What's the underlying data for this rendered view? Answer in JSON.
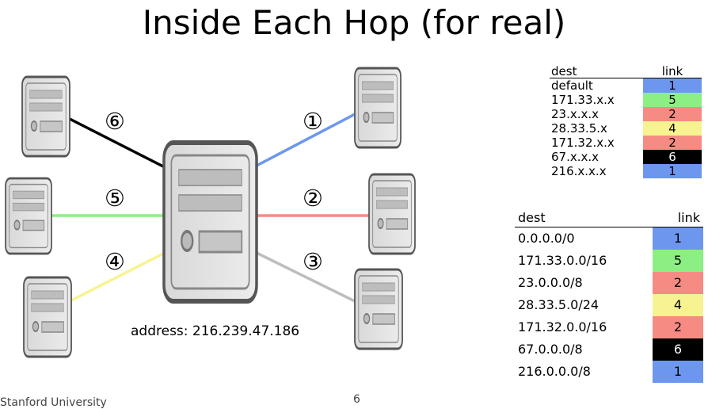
{
  "title": "Inside Each Hop (for real)",
  "address_label": "address: 216.239.47.186",
  "footer": "Stanford University",
  "page_number": "6",
  "link_labels": [
    "①",
    "②",
    "③",
    "④",
    "⑤",
    "⑥"
  ],
  "link_colors": {
    "1": "#6d97ee",
    "2": "#f58b82",
    "3": "#bdbdbd",
    "4": "#f7f390",
    "5": "#8cef83",
    "6": "#000000"
  },
  "table_small": {
    "headers": [
      "dest",
      "link"
    ],
    "rows": [
      {
        "dest": "default",
        "link": "1"
      },
      {
        "dest": "171.33.x.x",
        "link": "5"
      },
      {
        "dest": "23.x.x.x",
        "link": "2"
      },
      {
        "dest": "28.33.5.x",
        "link": "4"
      },
      {
        "dest": "171.32.x.x",
        "link": "2"
      },
      {
        "dest": "67.x.x.x",
        "link": "6"
      },
      {
        "dest": "216.x.x.x",
        "link": "1"
      }
    ]
  },
  "table_big": {
    "headers": [
      "dest",
      "link"
    ],
    "rows": [
      {
        "dest": "0.0.0.0/0",
        "link": "1"
      },
      {
        "dest": "171.33.0.0/16",
        "link": "5"
      },
      {
        "dest": "23.0.0.0/8",
        "link": "2"
      },
      {
        "dest": "28.33.5.0/24",
        "link": "4"
      },
      {
        "dest": "171.32.0.0/16",
        "link": "2"
      },
      {
        "dest": "67.0.0.0/8",
        "link": "6"
      },
      {
        "dest": "216.0.0.0/8",
        "link": "1"
      }
    ]
  }
}
